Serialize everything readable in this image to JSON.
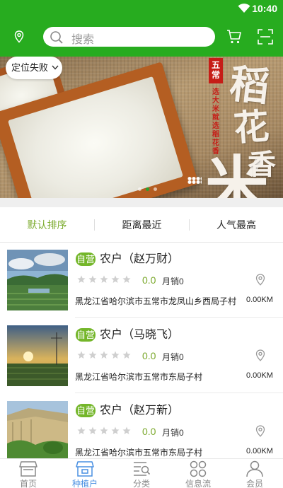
{
  "status_bar": {
    "time": "10:40"
  },
  "header": {
    "search_placeholder": "搜索"
  },
  "banner": {
    "location_chip": "定位失败",
    "seal_text": "五常",
    "vertical_slogan": "选大米就选稻花香",
    "calligraphy": [
      "稻",
      "花",
      "米",
      "香"
    ],
    "indicator_count": 3,
    "indicator_active": 1
  },
  "sort_tabs": [
    {
      "label": "默认排序",
      "active": true
    },
    {
      "label": "距离最近",
      "active": false
    },
    {
      "label": "人气最高",
      "active": false
    }
  ],
  "farms": [
    {
      "badge": "自营",
      "name": "农户（赵万财）",
      "rating": 0,
      "score": "0.0",
      "sales": "月销0",
      "address": "黑龙江省哈尔滨市五常市龙凤山乡西局子村",
      "distance": "0.00KM"
    },
    {
      "badge": "自营",
      "name": "农户（马晓飞）",
      "rating": 0,
      "score": "0.0",
      "sales": "月销0",
      "address": "黑龙江省哈尔滨市五常市东局子村",
      "distance": "0.00KM"
    },
    {
      "badge": "自营",
      "name": "农户（赵万新）",
      "rating": 0,
      "score": "0.0",
      "sales": "月销0",
      "address": "黑龙江省哈尔滨市五常市东局子村",
      "distance": "0.00KM"
    }
  ],
  "bottom_nav": [
    {
      "label": "首页",
      "icon": "store-icon",
      "active": false
    },
    {
      "label": "种植户",
      "icon": "farm-store-icon",
      "active": true
    },
    {
      "label": "分类",
      "icon": "category-icon",
      "active": false
    },
    {
      "label": "信息流",
      "icon": "grid-icon",
      "active": false
    },
    {
      "label": "会员",
      "icon": "person-icon",
      "active": false
    }
  ],
  "colors": {
    "primary": "#27ac1f",
    "accent_green": "#7aa82b",
    "badge": "#74b62a",
    "nav_active": "#4a90e2"
  }
}
